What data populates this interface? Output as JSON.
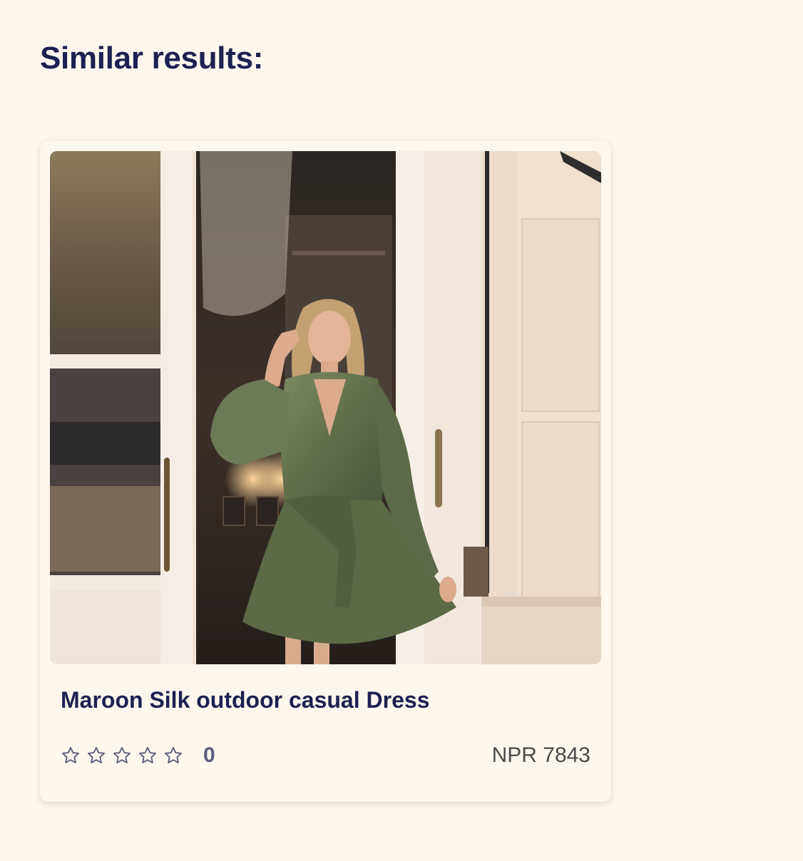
{
  "page": {
    "title": "Similar results:"
  },
  "results": [
    {
      "name": "Maroon Silk outdoor casual Dress",
      "rating_icons": [
        "star-outline-icon",
        "star-outline-icon",
        "star-outline-icon",
        "star-outline-icon",
        "star-outline-icon"
      ],
      "rating_filled": 0,
      "review_count": "0",
      "price": "NPR 7843",
      "image_icon": "product-photo"
    }
  ],
  "colors": {
    "background": "#fef7ee",
    "heading": "#1c2151",
    "star_outline": "#5a5e7e",
    "price": "#4a4a4a"
  }
}
